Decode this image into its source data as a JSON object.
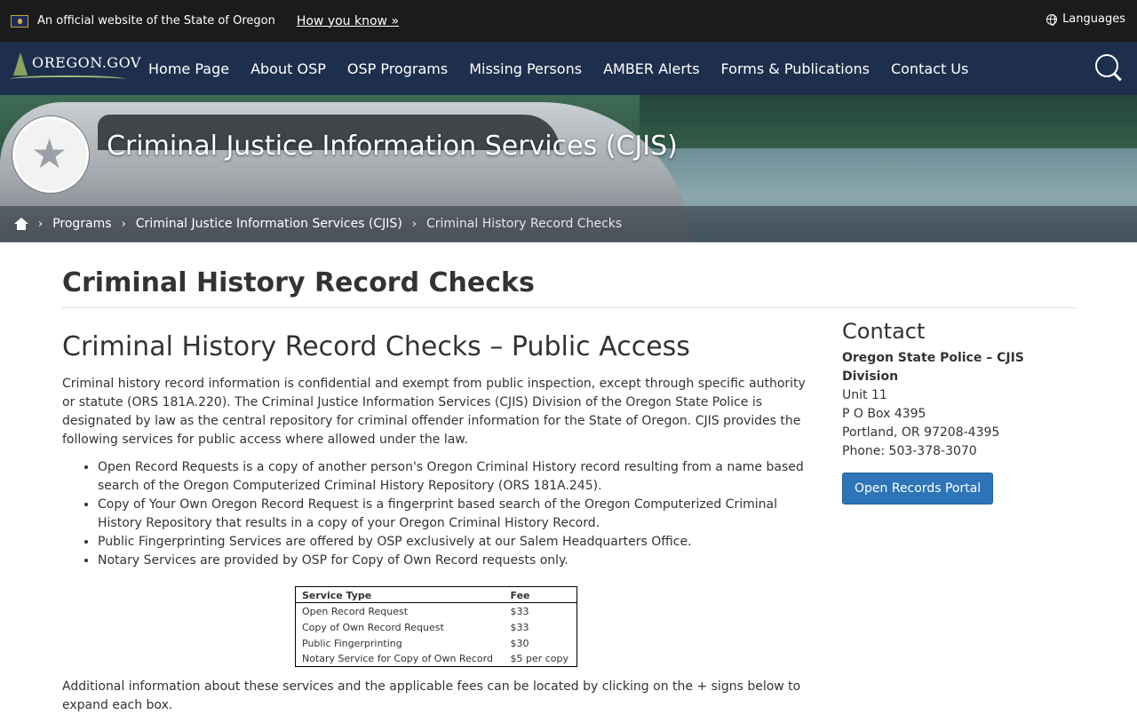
{
  "banner": {
    "official_text": "An official website of the State of Oregon",
    "how_you_know": "How you know »",
    "languages": "Languages"
  },
  "nav": {
    "logo_text": "OREGON.GOV",
    "items": [
      "Home Page",
      "About OSP",
      "OSP Programs",
      "Missing Persons",
      "AMBER Alerts",
      "Forms & Publications",
      "Contact Us"
    ]
  },
  "hero": {
    "title": "Criminal Justice Information Services (CJIS)"
  },
  "breadcrumb": {
    "items": [
      "Programs",
      "Criminal Justice Information Services (CJIS)"
    ],
    "current": "Criminal History Record Checks"
  },
  "page": {
    "title": "Criminal History Record Checks",
    "section_heading": "Criminal History Record Checks – Public Access",
    "intro": "Criminal history record information is confidential and exempt from public inspection, except through specific authority or statute (ORS 181A.220). The Criminal Justice Information Services (CJIS) Division of the Oregon State Police is designated by law as the central repository for criminal offender information for the State of Oregon. CJIS provides the following services for public access where allowed under the law.",
    "bullets": [
      "Open Record Requests is a copy of another person's Oregon Criminal History record resulting from a name based search of the Oregon Computerized Criminal History Repository (ORS 181A.245).",
      "Copy of Your Own Oregon Record Request is a fingerprint based search of the Oregon Computerized Criminal History Repository that results in a copy of your Oregon Criminal History Record.",
      "Public Fingerprinting Services are offered by OSP exclusively at our Salem Headquarters Office.",
      "Notary Services are provided by OSP for Copy of Own Record requests only."
    ],
    "fee_table": {
      "headers": [
        "Service Type",
        "Fee"
      ],
      "rows": [
        [
          "Open Record Request",
          "$33"
        ],
        [
          "Copy of Own Record Request",
          "$33"
        ],
        [
          "Public Fingerprinting",
          "$30"
        ],
        [
          "Notary Service for Copy of Own Record",
          "$5 per copy"
        ]
      ]
    },
    "after_table": "Additional information about these services and the applicable fees can be located by clicking on the + signs below to expand each box."
  },
  "contact": {
    "heading": "Contact",
    "org": "Oregon State Police – CJIS Division",
    "lines": [
      "Unit 11",
      "P O Box 4395",
      "Portland, OR 97208-4395",
      "Phone: 503-378-3070"
    ],
    "button": "Open Records Portal"
  },
  "colors": {
    "nav_bg": "#1e2f4d",
    "banner_bg": "#1b1b1b",
    "button_bg": "#2d74b8"
  }
}
